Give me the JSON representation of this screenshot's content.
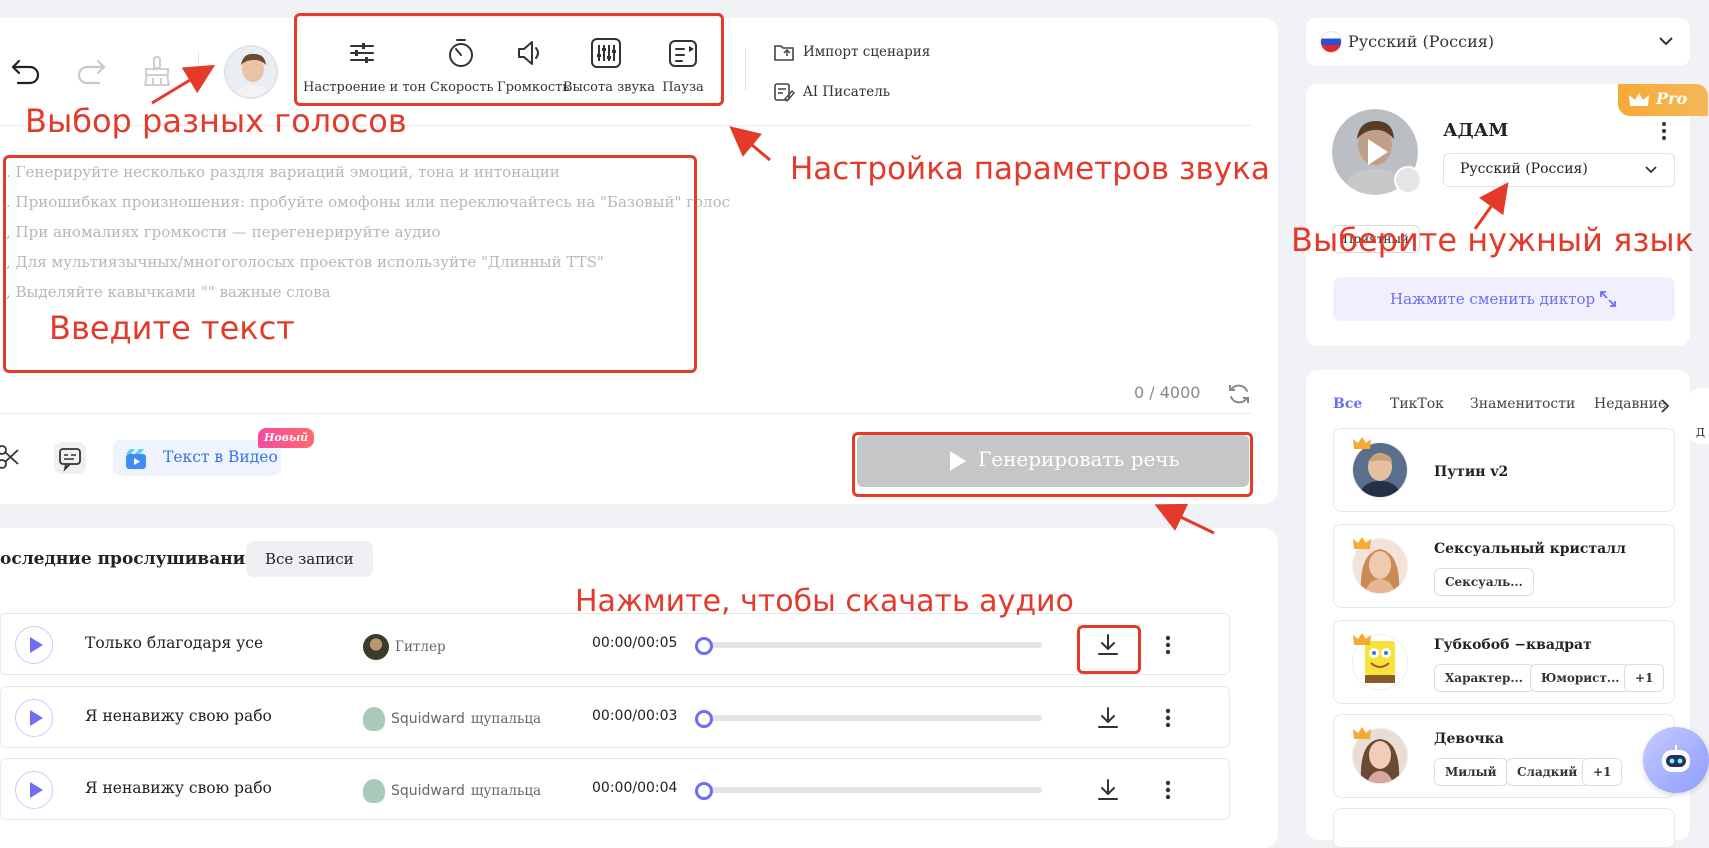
{
  "toolbar": {
    "tools": [
      {
        "label": "Настроение и тон",
        "icon": "sliders-icon"
      },
      {
        "label": "Скорость",
        "icon": "timer-icon"
      },
      {
        "label": "Громкость",
        "icon": "volume-icon"
      },
      {
        "label": "Высота звука",
        "icon": "equalizer-icon"
      },
      {
        "label": "Пауза",
        "icon": "pause-insert-icon"
      }
    ],
    "import_label": "Импорт сценария",
    "ai_writer_label": "AI Писатель"
  },
  "editor": {
    "placeholder_lines": [
      ". Генерируйте несколько раздля вариаций эмоций, тона и интонации",
      ". Приошибках произношения: пробуйте омофоны или переключайтесь на \"Базовый\" голос",
      ", При аномалиях громкости — перегенерируйте аудио",
      ", Для мультиязычных/многоголосых проектов используйте \"Длинный TTS\"",
      ", Выделяйте кавычками \"\" важные слова"
    ],
    "counter": "0 / 4000"
  },
  "actions": {
    "text_to_video_label": "Текст в Видео",
    "new_badge": "Новый",
    "generate_label": "Генерировать речь"
  },
  "history": {
    "title": "оследние прослушивания",
    "all_records_label": "Все записи",
    "rows": [
      {
        "title": "Только благодаря усе",
        "voice": "Гитлер",
        "time": "00:00/00:05",
        "progress": 0
      },
      {
        "title": "Я ненавижу свою рабо",
        "voice_prefix": "Squidward",
        "voice": "щупальца",
        "time": "00:00/00:03",
        "progress": 0
      },
      {
        "title": "Я ненавижу свою рабо",
        "voice_prefix": "Squidward",
        "voice": "щупальца",
        "time": "00:00/00:04",
        "progress": 0
      }
    ]
  },
  "sidebar": {
    "language_select": "Русский (Россия)",
    "pro_badge": "Pro",
    "speaker": {
      "name": "АДАМ",
      "language": "Русский (Россия)",
      "tag": "Приятный",
      "change_label": "Нажмите сменить диктор"
    },
    "tabs": [
      "Все",
      "ТикТок",
      "Знаменитости",
      "Недавние"
    ],
    "voices": [
      {
        "name": "Путин v2",
        "tags": []
      },
      {
        "name": "Сексуальный кристалл",
        "tags": [
          "Сексуаль..."
        ]
      },
      {
        "name": "Губкобоб −квадрат",
        "tags": [
          "Характер...",
          "Юморист...",
          "+1"
        ]
      },
      {
        "name": "Девочка",
        "tags": [
          "Милый",
          "Сладкий",
          "+1"
        ]
      }
    ],
    "edge_label": "Д"
  },
  "annotations": {
    "voices": "Выбор разных голосов",
    "sound_params": "Настройка параметров звука",
    "enter_text": "Введите текст",
    "choose_language": "Выберите нужный язык",
    "download": "Нажмите, чтобы скачать аудио"
  },
  "colors": {
    "accent": "#6d6ef5",
    "annotation_red": "#e43a2a",
    "pro_orange": "#f7a935",
    "generate_disabled": "#c6c6c9"
  }
}
